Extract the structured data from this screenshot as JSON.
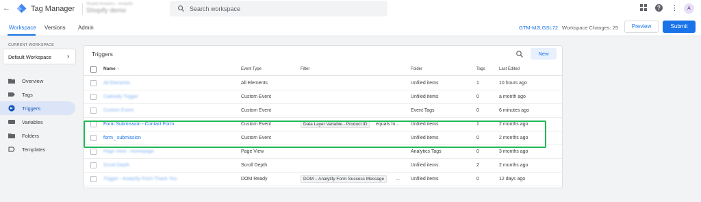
{
  "header": {
    "app_title": "Tag Manager",
    "account_line1": "Shopify Analytics – Analytify",
    "account_line2": "Shopify demo",
    "search_placeholder": "Search workspace",
    "avatar_initial": "A"
  },
  "subnav": {
    "tabs": [
      {
        "label": "Workspace",
        "active": true
      },
      {
        "label": "Versions",
        "active": false
      },
      {
        "label": "Admin",
        "active": false
      }
    ],
    "container_id": "GTM-M2LGSL72",
    "workspace_changes_label": "Workspace Changes: 25",
    "preview_label": "Preview",
    "submit_label": "Submit"
  },
  "sidebar": {
    "current_workspace_label": "CURRENT WORKSPACE",
    "workspace_name": "Default Workspace",
    "items": [
      {
        "label": "Overview",
        "icon": "folder-icon",
        "active": false
      },
      {
        "label": "Tags",
        "icon": "tag-icon",
        "active": false
      },
      {
        "label": "Triggers",
        "icon": "trigger-icon",
        "active": true
      },
      {
        "label": "Variables",
        "icon": "variables-icon",
        "active": false
      },
      {
        "label": "Folders",
        "icon": "folder-icon",
        "active": false
      },
      {
        "label": "Templates",
        "icon": "template-icon",
        "active": false
      }
    ]
  },
  "triggers": {
    "title": "Triggers",
    "new_label": "New",
    "columns": {
      "name": "Name ↑",
      "event_type": "Event Type",
      "filter": "Filter",
      "folder": "Folder",
      "tags": "Tags",
      "last_edited": "Last Edited"
    },
    "rows": [
      {
        "name": "All Elements",
        "event_type": "All Elements",
        "filter_chip": "",
        "filter_text": "",
        "folder": "Unfiled items",
        "tags": "1",
        "last_edited": "10 hours ago",
        "blurred": true
      },
      {
        "name": "Calendly Trigger",
        "event_type": "Custom Event",
        "filter_chip": "",
        "filter_text": "",
        "folder": "Unfiled items",
        "tags": "0",
        "last_edited": "a month ago",
        "blurred": true
      },
      {
        "name": "Custom Event",
        "event_type": "Custom Event",
        "filter_chip": "",
        "filter_text": "",
        "folder": "Event Tags",
        "tags": "0",
        "last_edited": "6 minutes ago",
        "blurred": true
      },
      {
        "name": "Form Submission - Contact Form",
        "event_type": "Custom Event",
        "filter_chip": "Data Layer Variable - Product ID",
        "filter_text": "equals fo...",
        "folder": "Unfiled items",
        "tags": "1",
        "last_edited": "2 months ago",
        "blurred": false
      },
      {
        "name": "form_ submission",
        "event_type": "Custom Event",
        "filter_chip": "",
        "filter_text": "",
        "folder": "Unfiled items",
        "tags": "0",
        "last_edited": "2 months ago",
        "blurred": false
      },
      {
        "name": "Page View - Homepage",
        "event_type": "Page View",
        "filter_chip": "",
        "filter_text": "",
        "folder": "Analytics Tags",
        "tags": "0",
        "last_edited": "3 months ago",
        "blurred": true
      },
      {
        "name": "Scroll Depth",
        "event_type": "Scroll Depth",
        "filter_chip": "",
        "filter_text": "",
        "folder": "Unfiled items",
        "tags": "2",
        "last_edited": "2 months ago",
        "blurred": true
      },
      {
        "name": "Trigger - Analytify Form Thank You",
        "event_type": "DOM Ready",
        "filter_chip": "DOM – Analytify Form Success Message",
        "filter_text": "...",
        "folder": "Unfiled items",
        "tags": "0",
        "last_edited": "12 days ago",
        "blurred": true
      }
    ]
  },
  "colors": {
    "accent": "#1a73e8",
    "highlight": "#20b858"
  }
}
